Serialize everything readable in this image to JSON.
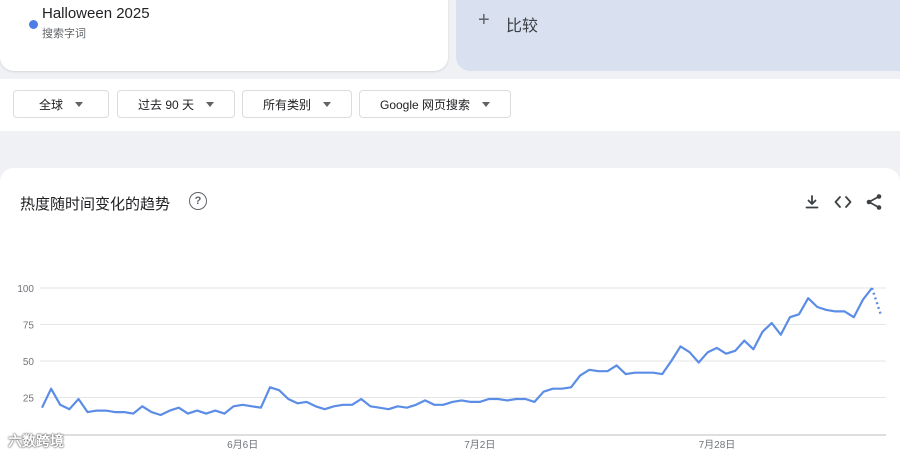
{
  "term": {
    "name": "Halloween 2025",
    "sub": "搜索字词"
  },
  "compare": {
    "label": "比较"
  },
  "filters": [
    {
      "label": "全球"
    },
    {
      "label": "过去 90 天"
    },
    {
      "label": "所有类别"
    },
    {
      "label": "Google 网页搜索"
    }
  ],
  "chart": {
    "title": "热度随时间变化的趋势"
  },
  "watermark": "六数跨境",
  "colors": {
    "series": "#5b8de6",
    "accent": "#4c7ee8"
  },
  "chart_data": {
    "type": "line",
    "ylim": [
      0,
      100
    ],
    "yticks": [
      100,
      75,
      50,
      25
    ],
    "xticks": [
      {
        "label": "6月6日",
        "index": 22
      },
      {
        "label": "7月2日",
        "index": 48
      },
      {
        "label": "7月28日",
        "index": 74
      }
    ],
    "series": [
      {
        "values": [
          18,
          31,
          20,
          17,
          24,
          15,
          16,
          16,
          15,
          15,
          14,
          19,
          15,
          13,
          16,
          18,
          14,
          16,
          14,
          16,
          14,
          19,
          20,
          19,
          18,
          32,
          30,
          24,
          21,
          22,
          19,
          17,
          19,
          20,
          20,
          24,
          19,
          18,
          17,
          19,
          18,
          20,
          23,
          20,
          20,
          22,
          23,
          22,
          22,
          24,
          24,
          23,
          24,
          24,
          22,
          29,
          31,
          31,
          32,
          40,
          44,
          43,
          43,
          47,
          41,
          42,
          42,
          42,
          41,
          50,
          60,
          56,
          49,
          56,
          59,
          55,
          57,
          64,
          58,
          70,
          76,
          68,
          80,
          82,
          93,
          87,
          85,
          84,
          84,
          80,
          92,
          100
        ],
        "partial": [
          100,
          82
        ]
      }
    ],
    "grid": true
  }
}
